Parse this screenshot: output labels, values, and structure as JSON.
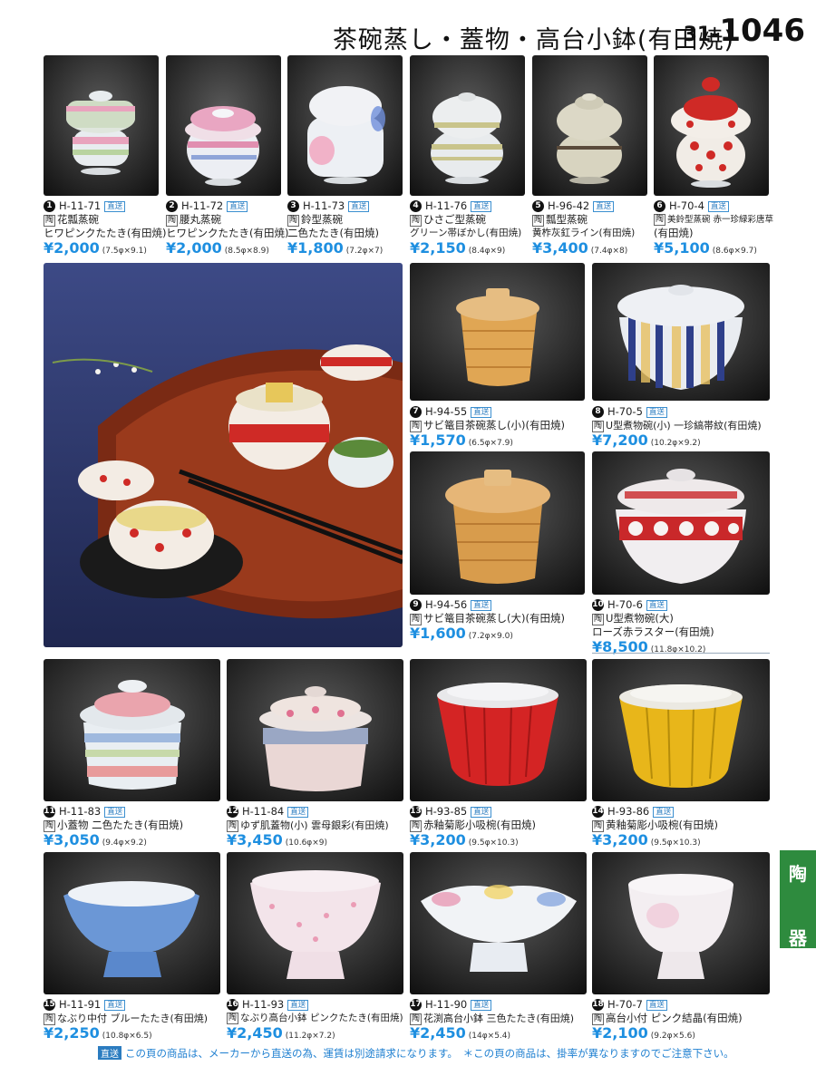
{
  "header": {
    "title": "茶碗蒸し・蓋物・高台小鉢(有田焼)",
    "page_prefix": "31-",
    "page_number": "1046"
  },
  "direct_badge": "直送",
  "material_badge": "陶",
  "side_tab": {
    "char1": "陶",
    "char2": "器"
  },
  "footer": {
    "badge": "直送",
    "text": "この頁の商品は、メーカーから直送の為、運賃は別途請求になります。　＊この頁の商品は、掛率が異なりますのでご注意下さい。"
  },
  "products": [
    {
      "no": "1",
      "code": "H-11-71",
      "name1": "花瓢蒸碗",
      "name2": "ヒワピンクたたき(有田焼)",
      "price": "¥2,000",
      "dims": "(7.5φ×9.1)"
    },
    {
      "no": "2",
      "code": "H-11-72",
      "name1": "腰丸蒸碗",
      "name2": "ヒワピンクたたき(有田焼)",
      "price": "¥2,000",
      "dims": "(8.5φ×8.9)"
    },
    {
      "no": "3",
      "code": "H-11-73",
      "name1": "鈴型蒸碗",
      "name2": "二色たたき(有田焼)",
      "price": "¥1,800",
      "dims": "(7.2φ×7)"
    },
    {
      "no": "4",
      "code": "H-11-76",
      "name1": "ひさご型蒸碗",
      "name2": "グリーン帯ぼかし(有田焼)",
      "price": "¥2,150",
      "dims": "(8.4φ×9)"
    },
    {
      "no": "5",
      "code": "H-96-42",
      "name1": "瓢型蒸碗",
      "name2": "黄柞灰釭ライン(有田焼)",
      "price": "¥3,400",
      "dims": "(7.4φ×8)"
    },
    {
      "no": "6",
      "code": "H-70-4",
      "name1": "美鈴型蒸碗 赤一珍緑彩唐草",
      "name2": "(有田焼)",
      "price": "¥5,100",
      "dims": "(8.6φ×9.7)"
    },
    {
      "no": "7",
      "code": "H-94-55",
      "name1": "サビ篭目茶碗蒸し(小)(有田焼)",
      "name2": "",
      "price": "¥1,570",
      "dims": "(6.5φ×7.9)"
    },
    {
      "no": "8",
      "code": "H-70-5",
      "name1": "U型煮物碗(小) 一珍縞帯紋(有田焼)",
      "name2": "",
      "price": "¥7,200",
      "dims": "(10.2φ×9.2)"
    },
    {
      "no": "9",
      "code": "H-94-56",
      "name1": "サビ篭目茶碗蒸し(大)(有田焼)",
      "name2": "",
      "price": "¥1,600",
      "dims": "(7.2φ×9.0)"
    },
    {
      "no": "10",
      "code": "H-70-6",
      "name1": "U型煮物碗(大)",
      "name2": "ローズ赤ラスター(有田焼)",
      "price": "¥8,500",
      "dims": "(11.8φ×10.2)"
    },
    {
      "no": "11",
      "code": "H-11-83",
      "name1": "小蓋物 二色たたき(有田焼)",
      "name2": "",
      "price": "¥3,050",
      "dims": "(9.4φ×9.2)"
    },
    {
      "no": "12",
      "code": "H-11-84",
      "name1": "ゆず肌蓋物(小) 雲母銀彩(有田焼)",
      "name2": "",
      "price": "¥3,450",
      "dims": "(10.6φ×9)"
    },
    {
      "no": "13",
      "code": "H-93-85",
      "name1": "赤釉菊彫小吸椀(有田焼)",
      "name2": "",
      "price": "¥3,200",
      "dims": "(9.5φ×10.3)"
    },
    {
      "no": "14",
      "code": "H-93-86",
      "name1": "黄釉菊彫小吸椀(有田焼)",
      "name2": "",
      "price": "¥3,200",
      "dims": "(9.5φ×10.3)"
    },
    {
      "no": "15",
      "code": "H-11-91",
      "name1": "なぶり中付 ブルーたたき(有田焼)",
      "name2": "",
      "price": "¥2,250",
      "dims": "(10.8φ×6.5)"
    },
    {
      "no": "16",
      "code": "H-11-93",
      "name1": "なぶり高台小鉢 ピンクたたき(有田焼)",
      "name2": "",
      "price": "¥2,450",
      "dims": "(11.2φ×7.2)"
    },
    {
      "no": "17",
      "code": "H-11-90",
      "name1": "花渕高台小鉢 三色たたき(有田焼)",
      "name2": "",
      "price": "¥2,450",
      "dims": "(14φ×5.4)"
    },
    {
      "no": "18",
      "code": "H-70-7",
      "name1": "高台小付 ピンク結晶(有田焼)",
      "name2": "",
      "price": "¥2,100",
      "dims": "(9.2φ×5.6)"
    }
  ],
  "colors": {
    "price_blue": "#1e8fe0",
    "tab_green": "#2e8b3e",
    "direct_blue": "#2b7cc0"
  }
}
